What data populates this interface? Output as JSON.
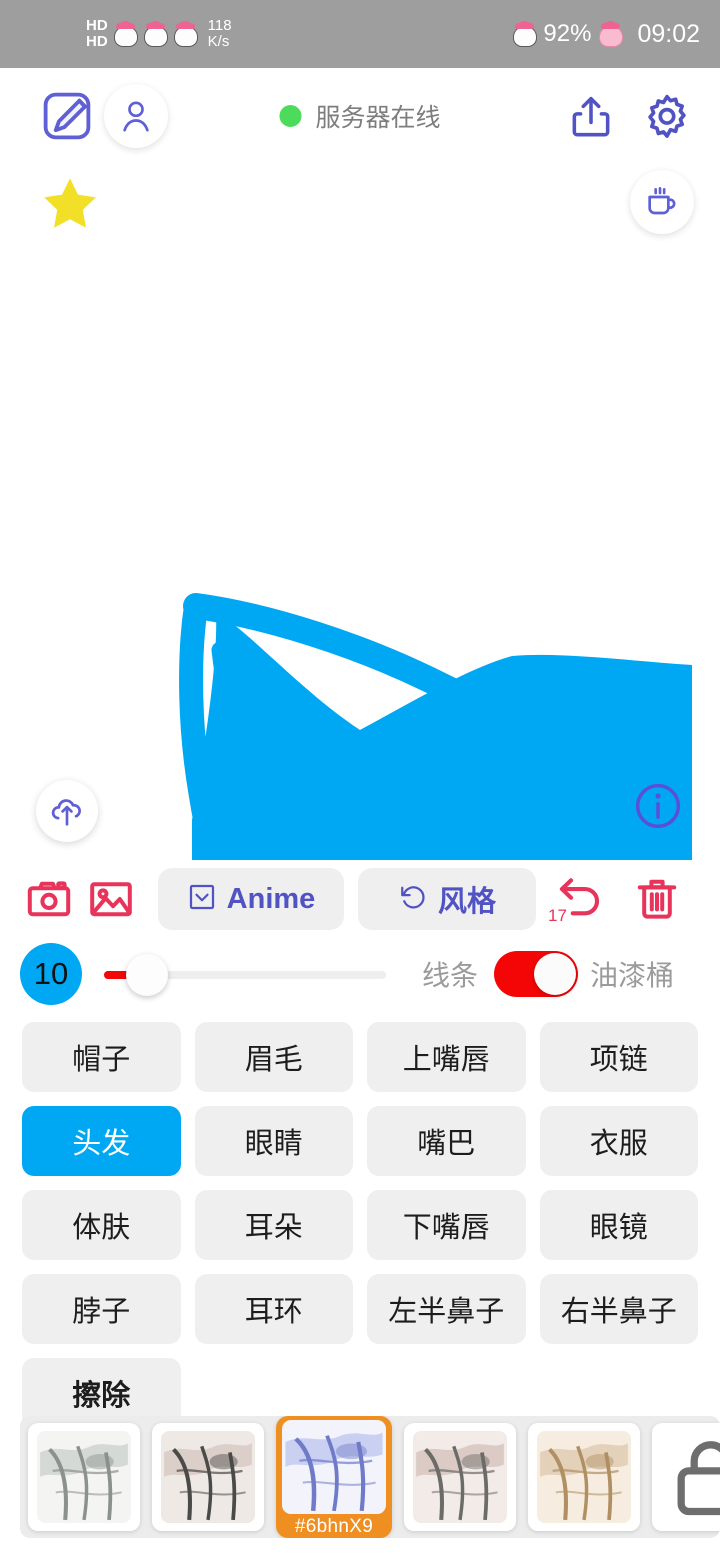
{
  "statusbar": {
    "network_label_1": "HD",
    "network_label_2": "HD",
    "speed_value": "118",
    "speed_unit": "K/s",
    "battery": "92%",
    "time": "09:02",
    "icons": [
      "kitty-sticker-icon",
      "kitty-sticker-icon",
      "kitty-sticker-icon",
      "kitty-battery-icon",
      "pig-sticker-icon"
    ]
  },
  "header": {
    "draw_icon": "pen-square-icon",
    "account_icon": "person-icon",
    "status_text": "服务器在线",
    "status_dot_color": "#4cdb5a",
    "share_icon": "share-upload-icon",
    "settings_icon": "gear-icon"
  },
  "subheader": {
    "favorite_icon": "star-icon",
    "favorite_color": "#f2e028",
    "coffee_icon": "coffee-cup-icon"
  },
  "canvas": {
    "stroke_color": "#00a8f3",
    "background": "#ffffff",
    "upload_icon": "cloud-upload-icon",
    "info_icon": "info-circle-icon"
  },
  "toolbar": {
    "camera_icon": "camera-icon",
    "gallery_icon": "image-icon",
    "anime_icon": "chevron-down-box-icon",
    "anime_label": "Anime",
    "style_icon": "refresh-undo-icon",
    "style_label": "风格",
    "undo_icon": "undo-arrow-icon",
    "undo_count": "17",
    "trash_icon": "trash-icon",
    "accent_pink": "#e8345a",
    "accent_purple": "#5153c4"
  },
  "brush": {
    "size_value": "10",
    "size_badge_color": "#00a8f3",
    "slider_fill_color": "#f50606",
    "slider_percent": 11,
    "mode_left_label": "线条",
    "mode_right_label": "油漆桶",
    "toggle_on": true,
    "toggle_color": "#f50606"
  },
  "parts": {
    "active_index": 4,
    "items": [
      {
        "label": "帽子"
      },
      {
        "label": "眉毛"
      },
      {
        "label": "上嘴唇"
      },
      {
        "label": "项链"
      },
      {
        "label": "头发"
      },
      {
        "label": "眼睛"
      },
      {
        "label": "嘴巴"
      },
      {
        "label": "衣服"
      },
      {
        "label": "体肤"
      },
      {
        "label": "耳朵"
      },
      {
        "label": "下嘴唇"
      },
      {
        "label": "眼镜"
      },
      {
        "label": "脖子"
      },
      {
        "label": "耳环"
      },
      {
        "label": "左半鼻子"
      },
      {
        "label": "右半鼻子"
      },
      {
        "label": "擦除"
      }
    ]
  },
  "thumbnails": {
    "selected_index": 2,
    "selected_tag": "#6bhnX9",
    "selected_border_color": "#ef8f22",
    "items": [
      {
        "name": "sketch-gray-1",
        "tone": "gray"
      },
      {
        "name": "sketch-dark-2",
        "tone": "dark"
      },
      {
        "name": "sketch-blue-3",
        "tone": "blue"
      },
      {
        "name": "sketch-gray-4",
        "tone": "gray2"
      },
      {
        "name": "sketch-sepia-5",
        "tone": "sepia"
      },
      {
        "name": "locked-slot-6",
        "tone": "lock"
      }
    ]
  }
}
